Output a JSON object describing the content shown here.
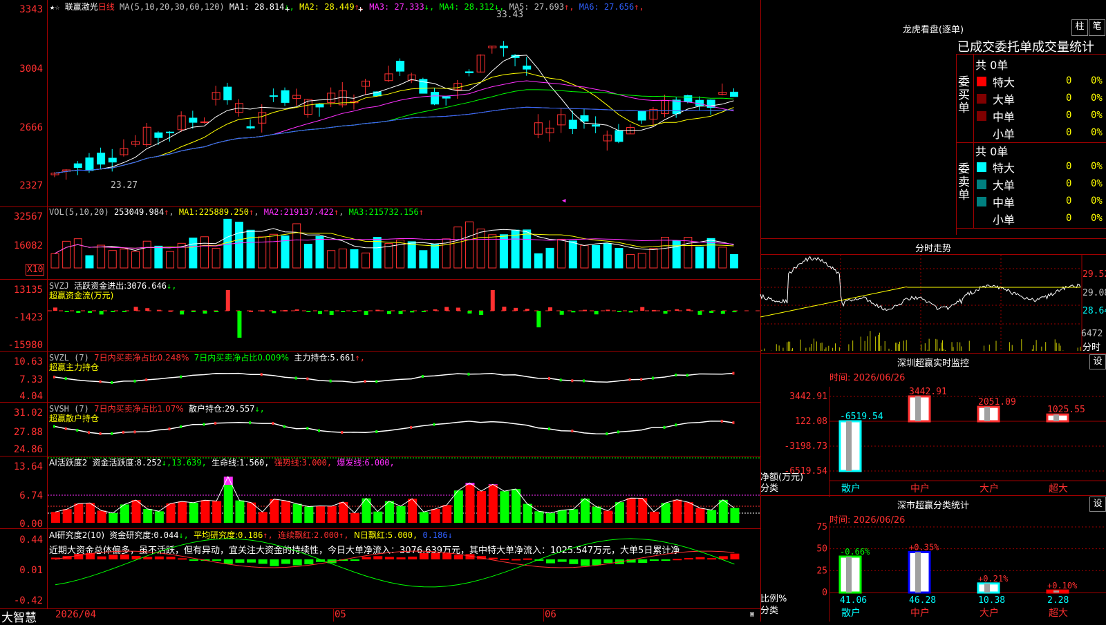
{
  "brand": "大智慧",
  "main": {
    "stock_name": "联赢激光",
    "period": "日线",
    "ma_params": "MA(5,10,20,30,60,120)",
    "ma_values": [
      {
        "name": "MA1:",
        "value": "28.814",
        "arrow": "↓",
        "color": "#ffffff"
      },
      {
        "name": "MA2:",
        "value": "28.449",
        "arrow": "↑",
        "color": "#ffff00"
      },
      {
        "name": "MA3:",
        "value": "27.333",
        "arrow": "↓",
        "color": "#ff30ff"
      },
      {
        "name": "MA4:",
        "value": "28.312",
        "arrow": "↓",
        "color": "#00ff00"
      },
      {
        "name": "MA5:",
        "value": "27.693",
        "arrow": "↑",
        "color": "#c0c0c0"
      },
      {
        "name": "MA6:",
        "value": "27.656",
        "arrow": "↑",
        "color": "#3060ff"
      }
    ],
    "y_labels": [
      "3343",
      "3004",
      "2666",
      "2327"
    ],
    "high_label": "33.43",
    "low_label": "23.27"
  },
  "vol": {
    "legend": "VOL(5,10,20)",
    "value": "253049.984",
    "ma1_label": "MA1:",
    "ma1": "225889.250",
    "ma2_label": "MA2:",
    "ma2": "219137.422",
    "ma3_label": "MA3:",
    "ma3": "215732.156",
    "arrow": "↑",
    "y_labels": [
      "32567",
      "16082"
    ],
    "unit": "X10"
  },
  "svzj": {
    "legend": "SVZJ",
    "text": "活跃资金进出:",
    "value": "3076.646",
    "arrow": "↓,",
    "title": "超赢资金流(万元)",
    "y_labels": [
      "13135",
      "-1423",
      "-15980"
    ]
  },
  "svzl": {
    "legend": "SVZL (7)",
    "t1": "7日内买卖净占比0.248%",
    "t2": "7日内买卖净占比0.009%",
    "t3": "主力持仓:",
    "value": "5.661",
    "arrow": "↑,",
    "title": "超赢主力持仓",
    "y_labels": [
      "10.63",
      "7.33",
      "4.04"
    ]
  },
  "svsh": {
    "legend": "SVSH (7)",
    "t1": "7日内买卖净占比1.07%",
    "t2": "散户持仓:",
    "value": "29.557",
    "arrow": "↓,",
    "title": "超赢散户持仓",
    "y_labels": [
      "31.02",
      "27.88",
      "24.86"
    ]
  },
  "ai1": {
    "legend": "AI活跃度2",
    "t1": "资金活跃度:",
    "v1": "8.252",
    "a1": "↓,",
    "v2": "13.639,",
    "t2": "生命线:",
    "v3": "1.560,",
    "t3": "强势线:",
    "v4": "3.000,",
    "t4": "爆发线:",
    "v5": "6.000,",
    "y_labels": [
      "13.64",
      "6.74",
      "0.00"
    ]
  },
  "ai2": {
    "legend": "AI研究度2(10)",
    "t1": "资金研究度:",
    "v1": "0.044",
    "a1": "↓,",
    "t2": "平均研究度:",
    "v2": "0.186",
    "a2": "↑,",
    "t3": "连续飘红:",
    "v3": "2.000",
    "a3": "↑,",
    "t4": "N日飘红:",
    "v4": "5.000,",
    "v5": "0.186",
    "a5": "↓",
    "comment": "近期大资金总体偏多，虽不活跃，但有异动，宜关注大资金的持续性，今日大单净流入：3076.639万元，其中特大单净流入：1025.547万元，大单5日累计净",
    "y_labels": [
      "0.44",
      "0.01",
      "-0.42"
    ]
  },
  "xaxis": {
    "labels": [
      "2026/04",
      "05",
      "06"
    ]
  },
  "dragon": {
    "title": "龙虎看盘(逐单)",
    "btn1": "柱",
    "btn2": "笔",
    "subtitle": "已成交委托单成交量统计",
    "buy_side": "委买单",
    "sell_side": "委卖单",
    "buy_total": "共 0单",
    "sell_total": "共 0单",
    "rows_buy": [
      {
        "label": "特大",
        "count": "0",
        "pct": "0%",
        "color": "#ff0000"
      },
      {
        "label": "大单",
        "count": "0",
        "pct": "0%",
        "color": "#800000"
      },
      {
        "label": "中单",
        "count": "0",
        "pct": "0%",
        "color": "#800000"
      },
      {
        "label": "小单",
        "count": "0",
        "pct": "0%",
        "color": ""
      }
    ],
    "rows_sell": [
      {
        "label": "特大",
        "count": "0",
        "pct": "0%",
        "color": "#00ffff"
      },
      {
        "label": "大单",
        "count": "0",
        "pct": "0%",
        "color": "#008080"
      },
      {
        "label": "中单",
        "count": "0",
        "pct": "0%",
        "color": "#008080"
      },
      {
        "label": "小单",
        "count": "0",
        "pct": "0%",
        "color": ""
      }
    ]
  },
  "intraday": {
    "title": "分时走势",
    "y_labels": [
      "29.52",
      "29.08",
      "28.64",
      "6472"
    ],
    "time_label": "分时"
  },
  "monitor": {
    "title": "深圳超赢实时监控",
    "btn": "设",
    "time": "时间: 2026/06/26",
    "y_labels": [
      "3442.91",
      "122.08",
      "-3198.73",
      "-6519.54"
    ],
    "ylabel": "净额(万元)",
    "xlabel": "分类",
    "categories": [
      "散户",
      "中户",
      "大户",
      "超大"
    ],
    "values": [
      -6519.54,
      3442.91,
      2051.09,
      1025.55
    ],
    "value_labels": [
      "-6519.54",
      "3442.91",
      "2051.09",
      "1025.55"
    ]
  },
  "classify": {
    "title": "深市超赢分类统计",
    "btn": "设",
    "time": "时间: 2026/06/26",
    "y_labels": [
      "75",
      "50",
      "25",
      "0"
    ],
    "ylabel": "比例%",
    "xlabel": "分类",
    "categories": [
      "散户",
      "中户",
      "大户",
      "超大"
    ],
    "values": [
      41.06,
      46.28,
      10.38,
      2.28
    ],
    "value_labels": [
      "41.06",
      "46.28",
      "10.38",
      "2.28"
    ],
    "change_labels": [
      "-0.66%",
      "+0.35%",
      "+0.21%",
      "+0.10%"
    ]
  },
  "colors": {
    "up": "#ff3030",
    "down": "#00ffff",
    "grid": "#a00000"
  }
}
